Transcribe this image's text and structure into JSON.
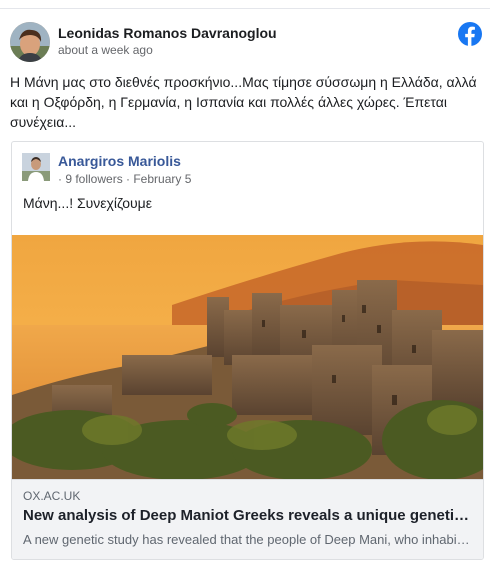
{
  "post": {
    "author": "Leonidas Romanos Davranoglou",
    "time": "about a week ago",
    "text": "Η Μάνη μας στο διεθνές προσκήνιο...Μας τίμησε σύσσωμη η Ελλάδα, αλλά και η Οξφόρδη, η Γερμανία, η Ισπανία και πολλές άλλες χώρες. Έπεται συνέχεια...",
    "platform_icon": "facebook-icon"
  },
  "shared": {
    "author": "Anargiros Mariolis",
    "meta": "· 9 followers · February 5",
    "text": "Μάνη...! Συνεχίζουμε"
  },
  "link": {
    "domain": "OX.AC.UK",
    "title": "New analysis of Deep Maniot Greeks reveals a unique genetic heritage",
    "description": "A new genetic study has revealed that the people of Deep Mani, who inhabit the southernmost tip of the Peloponnese"
  },
  "colors": {
    "facebook_blue": "#1877f2",
    "shared_name": "#385898"
  }
}
